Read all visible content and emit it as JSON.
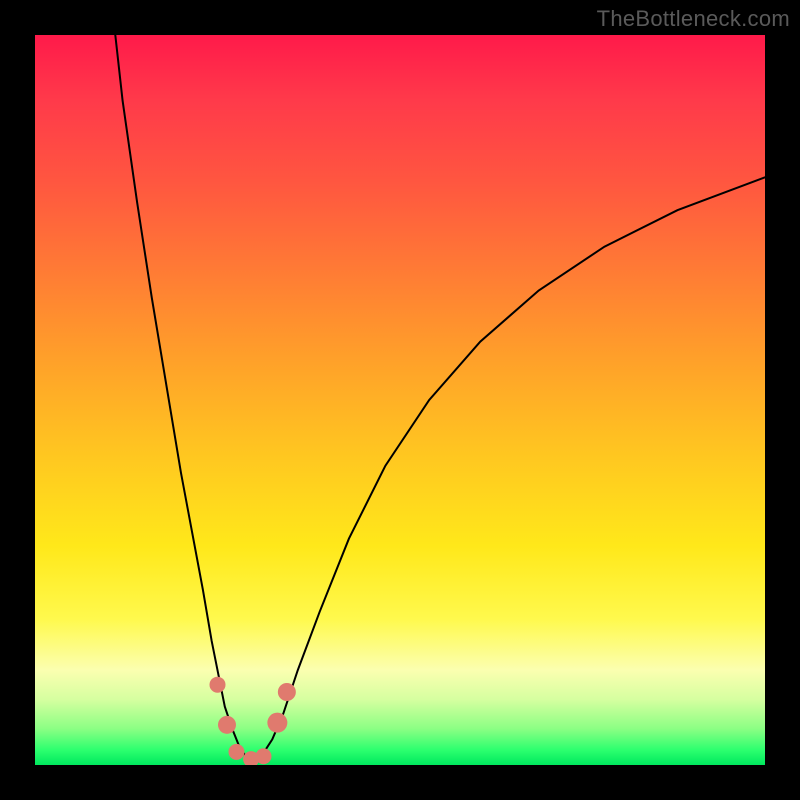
{
  "watermark": "TheBottleneck.com",
  "chart_data": {
    "type": "line",
    "title": "",
    "xlabel": "",
    "ylabel": "",
    "xlim": [
      0,
      100
    ],
    "ylim": [
      0,
      100
    ],
    "series": [
      {
        "name": "left-curve",
        "x": [
          11,
          12,
          14,
          16,
          18,
          20,
          21.5,
          23,
          24.2,
          25.2,
          26,
          27,
          28,
          29,
          30
        ],
        "y": [
          100,
          91,
          77,
          64,
          52,
          40,
          32,
          24,
          17,
          12,
          8,
          5,
          2.5,
          1,
          0.5
        ]
      },
      {
        "name": "right-curve",
        "x": [
          30,
          31,
          32.5,
          34,
          36,
          39,
          43,
          48,
          54,
          61,
          69,
          78,
          88,
          100
        ],
        "y": [
          0.5,
          1.2,
          3.5,
          7,
          13,
          21,
          31,
          41,
          50,
          58,
          65,
          71,
          76,
          80.5
        ]
      }
    ],
    "markers": [
      {
        "name": "dot-left-upper",
        "x": 25.0,
        "y": 11.0,
        "r": 8
      },
      {
        "name": "dot-left-mid",
        "x": 26.3,
        "y": 5.5,
        "r": 9
      },
      {
        "name": "dot-bottom-a",
        "x": 27.6,
        "y": 1.8,
        "r": 8
      },
      {
        "name": "dot-bottom-b",
        "x": 29.6,
        "y": 0.8,
        "r": 8
      },
      {
        "name": "dot-bottom-c",
        "x": 31.3,
        "y": 1.2,
        "r": 8
      },
      {
        "name": "dot-right-mid",
        "x": 33.2,
        "y": 5.8,
        "r": 10
      },
      {
        "name": "dot-right-upper",
        "x": 34.5,
        "y": 10.0,
        "r": 9
      }
    ],
    "marker_color": "#e07a6e",
    "curve_color": "#000000"
  }
}
